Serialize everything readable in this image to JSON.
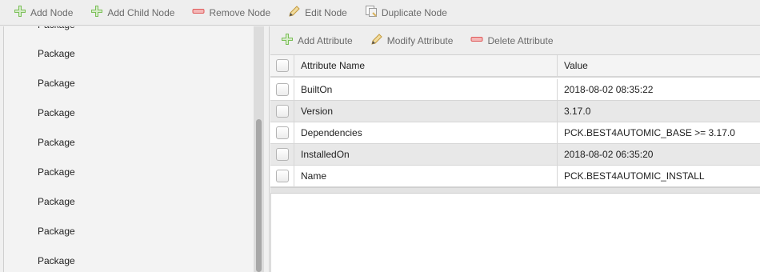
{
  "toolbar": {
    "add_node": "Add Node",
    "add_child_node": "Add Child Node",
    "remove_node": "Remove Node",
    "edit_node": "Edit Node",
    "duplicate_node": "Duplicate Node"
  },
  "tree": {
    "items": [
      "Package",
      "Package",
      "Package",
      "Package",
      "Package",
      "Package",
      "Package",
      "Package",
      "Package"
    ]
  },
  "attr_toolbar": {
    "add_attribute": "Add Attribute",
    "modify_attribute": "Modify Attribute",
    "delete_attribute": "Delete Attribute"
  },
  "table": {
    "columns": {
      "name": "Attribute Name",
      "value": "Value"
    },
    "rows": [
      {
        "name": "BuiltOn",
        "value": "2018-08-02 08:35:22"
      },
      {
        "name": "Version",
        "value": "3.17.0"
      },
      {
        "name": "Dependencies",
        "value": "PCK.BEST4AUTOMIC_BASE >= 3.17.0"
      },
      {
        "name": "InstalledOn",
        "value": "2018-08-02 06:35:20"
      },
      {
        "name": "Name",
        "value": "PCK.BEST4AUTOMIC_INSTALL"
      }
    ]
  },
  "colors": {
    "plus_green": "#7bbf58",
    "minus_red": "#e05a5a",
    "pencil": "#d9b25b"
  }
}
